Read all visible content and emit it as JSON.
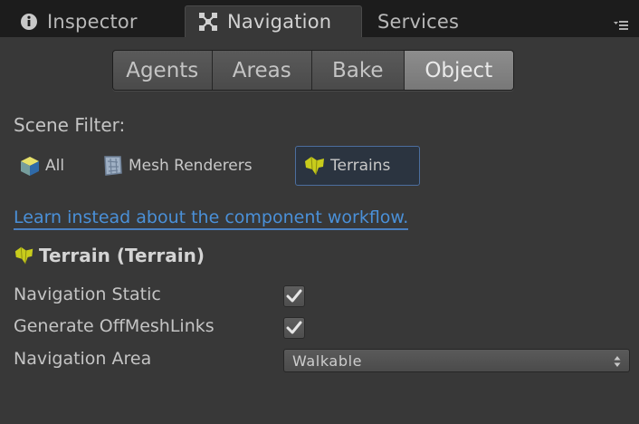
{
  "tabs": {
    "inspector": {
      "label": "Inspector",
      "icon": "info-icon"
    },
    "navigation": {
      "label": "Navigation",
      "icon": "navigation-icon",
      "active": true
    },
    "services": {
      "label": "Services"
    }
  },
  "modes": {
    "agents": "Agents",
    "areas": "Areas",
    "bake": "Bake",
    "object": "Object",
    "selected": "Object"
  },
  "scene_filter": {
    "label": "Scene Filter:",
    "options": {
      "all": "All",
      "mesh_renderers": "Mesh Renderers",
      "terrains": "Terrains"
    },
    "selected": "Terrains"
  },
  "learn_link": "Learn instead about the component workflow.",
  "object": {
    "title": "Terrain (Terrain)",
    "navigation_static": {
      "label": "Navigation Static",
      "checked": true
    },
    "generate_offmeshlinks": {
      "label": "Generate OffMeshLinks",
      "checked": true
    },
    "navigation_area": {
      "label": "Navigation Area",
      "value": "Walkable"
    }
  },
  "colors": {
    "background": "#383838",
    "tab_strip": "#1c1c1c",
    "link": "#4a90d8",
    "selected_outline": "#4c6e9e",
    "terrain_icon": "#c8cc1c"
  }
}
